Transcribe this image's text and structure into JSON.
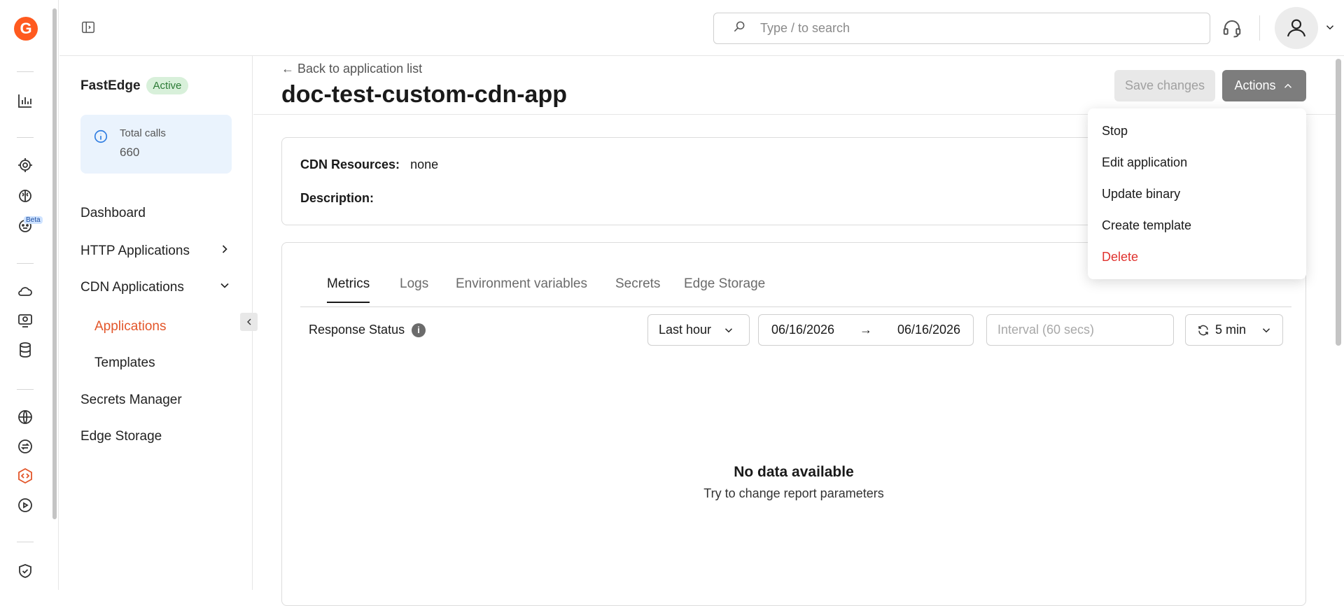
{
  "topbar": {
    "search_placeholder": "Type / to search"
  },
  "rail": {
    "beta_label": "Beta"
  },
  "sidebar": {
    "product_name": "FastEdge",
    "status_badge": "Active",
    "total_calls_label": "Total calls",
    "total_calls_value": "660",
    "items": [
      {
        "label": "Dashboard"
      },
      {
        "label": "HTTP Applications"
      },
      {
        "label": "CDN Applications"
      },
      {
        "label": "Applications"
      },
      {
        "label": "Templates"
      },
      {
        "label": "Secrets Manager"
      },
      {
        "label": "Edge Storage"
      }
    ]
  },
  "header": {
    "back_link": "Back to application list",
    "title": "doc-test-custom-cdn-app",
    "save_label": "Save changes",
    "actions_label": "Actions"
  },
  "info": {
    "cdn_label": "CDN Resources:",
    "cdn_value": "none",
    "description_label": "Description:"
  },
  "tabs": [
    {
      "label": "Metrics"
    },
    {
      "label": "Logs"
    },
    {
      "label": "Environment variables"
    },
    {
      "label": "Secrets"
    },
    {
      "label": "Edge Storage"
    }
  ],
  "metrics": {
    "response_status_label": "Response Status",
    "range_select": "Last hour",
    "date_from": "06/16/2026",
    "date_to": "06/16/2026",
    "interval_placeholder": "Interval (60 secs)",
    "refresh_value": "5 min",
    "nodata_title": "No data available",
    "nodata_hint": "Try to change report parameters"
  },
  "actions_menu": [
    {
      "label": "Stop"
    },
    {
      "label": "Edit application"
    },
    {
      "label": "Update binary"
    },
    {
      "label": "Create template"
    },
    {
      "label": "Delete"
    }
  ],
  "colors": {
    "accent": "#e3562a",
    "danger": "#e0332f",
    "active_badge_bg": "#d8f0da",
    "info_box_bg": "#eaf3fd"
  }
}
